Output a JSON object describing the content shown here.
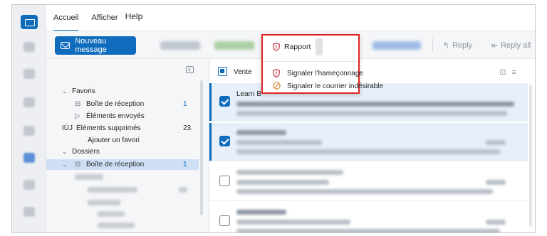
{
  "tabs": {
    "home": "Accueil",
    "view": "Afficher",
    "help": "Help"
  },
  "ribbon": {
    "new_message": "Nouveau message",
    "reply": "Reply",
    "reply_all": "Reply all"
  },
  "folders": {
    "favorites": "Favoris",
    "fav_inbox": "Boîte de réception",
    "fav_inbox_count": "1",
    "sent": "Éléments envoyés",
    "deleted_prefix": "IÙJ",
    "deleted": "Éléments supprimés",
    "deleted_count": "23",
    "add_favorite": "Ajouter un favori",
    "folders_section": "Dossiers",
    "inbox": "Boîte de réception",
    "inbox_count": "1"
  },
  "list": {
    "header_label": "Vente",
    "msg1_sender": "Learn B"
  },
  "popup": {
    "report": "Rapport",
    "phishing": "Signaler l'hameçonnage",
    "junk": "Signaler le courrier indésirable"
  },
  "colors": {
    "accent": "#0f6cbd",
    "highlight_border": "#e02424",
    "shield": "#c4314b",
    "junk_icon": "#d08a2b"
  }
}
